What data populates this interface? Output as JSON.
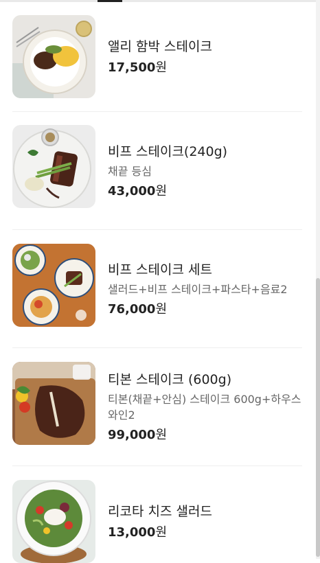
{
  "menu": {
    "items": [
      {
        "name": "앨리 함박 스테이크",
        "desc": "",
        "price": "17,500",
        "unit": "원",
        "photo": "hamburg-steak-plate"
      },
      {
        "name": "비프 스테이크(240g)",
        "desc": "채끝 등심",
        "price": "43,000",
        "unit": "원",
        "photo": "beef-steak-plate"
      },
      {
        "name": "비프 스테이크 세트",
        "desc": "샐러드+비프 스테이크+파스타+음료2",
        "price": "76,000",
        "unit": "원",
        "photo": "steak-set-table"
      },
      {
        "name": "티본 스테이크 (600g)",
        "desc": "티본(채끝+안심) 스테이크 600g+하우스 와인2",
        "price": "99,000",
        "unit": "원",
        "photo": "t-bone-board"
      },
      {
        "name": "리코타 치즈 샐러드",
        "desc": "",
        "price": "13,000",
        "unit": "원",
        "photo": "ricotta-salad-bowl"
      }
    ]
  }
}
